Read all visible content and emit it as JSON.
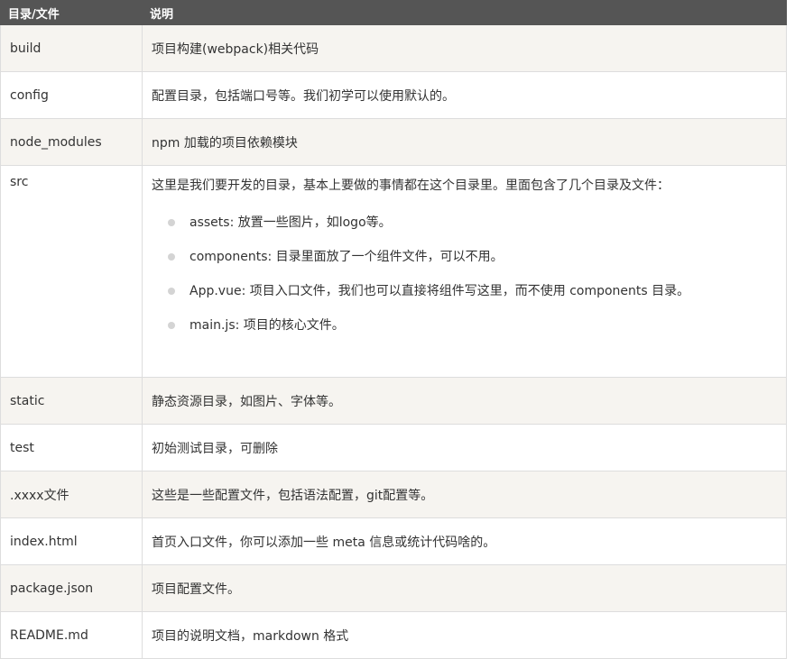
{
  "table": {
    "headers": [
      "目录/文件",
      "说明"
    ],
    "rows": [
      {
        "name": "build",
        "desc": "项目构建(webpack)相关代码"
      },
      {
        "name": "config",
        "desc": "配置目录，包括端口号等。我们初学可以使用默认的。"
      },
      {
        "name": "node_modules",
        "desc": "npm 加载的项目依赖模块"
      },
      {
        "name": "src",
        "desc": "这里是我们要开发的目录，基本上要做的事情都在这个目录里。里面包含了几个目录及文件：",
        "bullets": [
          "assets: 放置一些图片，如logo等。",
          "components: 目录里面放了一个组件文件，可以不用。",
          "App.vue: 项目入口文件，我们也可以直接将组件写这里，而不使用 components 目录。",
          "main.js: 项目的核心文件。"
        ]
      },
      {
        "name": "static",
        "desc": "静态资源目录，如图片、字体等。"
      },
      {
        "name": "test",
        "desc": "初始测试目录，可删除"
      },
      {
        "name": ".xxxx文件",
        "desc": "这些是一些配置文件，包括语法配置，git配置等。"
      },
      {
        "name": "index.html",
        "desc": "首页入口文件，你可以添加一些 meta 信息或统计代码啥的。"
      },
      {
        "name": "package.json",
        "desc": "项目配置文件。"
      },
      {
        "name": "README.md",
        "desc": "项目的说明文档，markdown 格式"
      }
    ]
  }
}
